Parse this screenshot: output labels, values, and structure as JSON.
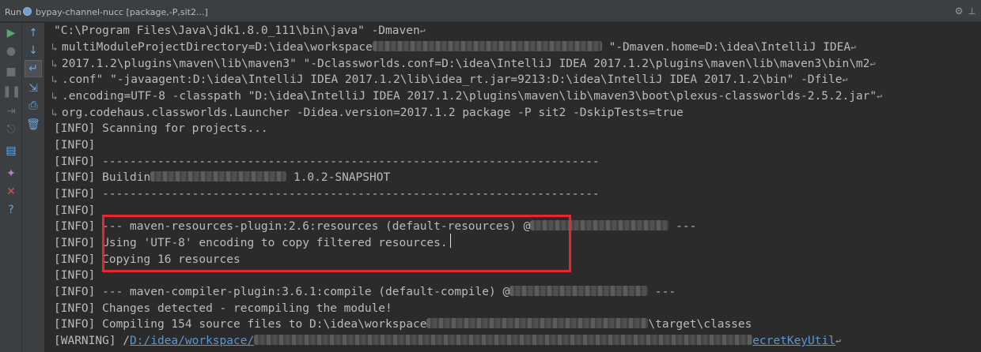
{
  "run_bar": {
    "run_label": "Run",
    "config_name": "bypay-channel-nucc [package,-P,sit2...]",
    "right_icons": [
      "gear-icon",
      "pin-icon"
    ]
  },
  "toolbar_left": [
    "rerun-icon",
    "stop-icon",
    "pause-icon",
    "step-icon",
    "dump-threads-icon",
    "layout-icon",
    "pin-tab-icon",
    "close-icon",
    "help-icon"
  ],
  "toolbar_right": [
    "up-icon",
    "down-icon",
    "soft-wrap-icon",
    "scroll-to-end-icon",
    "print-icon",
    "clear-icon"
  ],
  "console": {
    "lines": [
      {
        "prefix": "",
        "text": "\"C:\\Program Files\\Java\\jdk1.8.0_111\\bin\\java\" -Dmaven"
      },
      {
        "prefix": "",
        "text": "multiModuleProjectDirectory=D:\\idea\\workspace",
        "blur_w": 290,
        "text2": " \"-Dmaven.home=D:\\idea\\IntelliJ IDEA"
      },
      {
        "prefix": "",
        "text": "2017.1.2\\plugins\\maven\\lib\\maven3\" \"-Dclassworlds.conf=D:\\idea\\IntelliJ IDEA 2017.1.2\\plugins\\maven\\lib\\maven3\\bin\\m2"
      },
      {
        "prefix": "",
        "text": ".conf\" \"-javaagent:D:\\idea\\IntelliJ IDEA 2017.1.2\\lib\\idea_rt.jar=9213:D:\\idea\\IntelliJ IDEA 2017.1.2\\bin\" -Dfile"
      },
      {
        "prefix": "",
        "text": ".encoding=UTF-8 -classpath \"D:\\idea\\IntelliJ IDEA 2017.1.2\\plugins\\maven\\lib\\maven3\\boot\\plexus-classworlds-2.5.2.jar\""
      },
      {
        "prefix": "",
        "text": "org.codehaus.classworlds.Launcher -Didea.version=2017.1.2 package -P sit2 -DskipTests=true"
      },
      {
        "prefix": "[INFO]",
        "text": " Scanning for projects..."
      },
      {
        "prefix": "[INFO]",
        "text": ""
      },
      {
        "prefix": "[INFO]",
        "text": " ------------------------------------------------------------------------"
      },
      {
        "prefix": "[INFO]",
        "text": " Buildin",
        "blur_w": 172,
        "text2": " 1.0.2-SNAPSHOT"
      },
      {
        "prefix": "[INFO]",
        "text": " ------------------------------------------------------------------------"
      },
      {
        "prefix": "[INFO]",
        "text": ""
      },
      {
        "prefix": "[INFO]",
        "text": " --- maven-resources-plugin:2.6:resources (default-resources) @",
        "blur_w": 175,
        "text2": " ---"
      },
      {
        "prefix": "[INFO]",
        "text": " Using 'UTF-8' encoding to copy filtered resources."
      },
      {
        "prefix": "[INFO]",
        "text": " Copying 16 resources"
      },
      {
        "prefix": "[INFO]",
        "text": ""
      },
      {
        "prefix": "[INFO]",
        "text": " --- maven-compiler-plugin:3.6.1:compile (default-compile) @",
        "blur_w": 175,
        "text2": " ---"
      },
      {
        "prefix": "[INFO]",
        "text": " Changes detected - recompiling the module!"
      },
      {
        "prefix": "[INFO]",
        "text": " Compiling 154 source files to D:\\idea\\workspace",
        "blur_w": 280,
        "text2": "\\target\\classes"
      },
      {
        "prefix": "[WARNING]",
        "text": " /",
        "link": "D:/idea/workspace/",
        "blur_w": 630,
        "link2": "ecretKeyUtil"
      }
    ]
  }
}
